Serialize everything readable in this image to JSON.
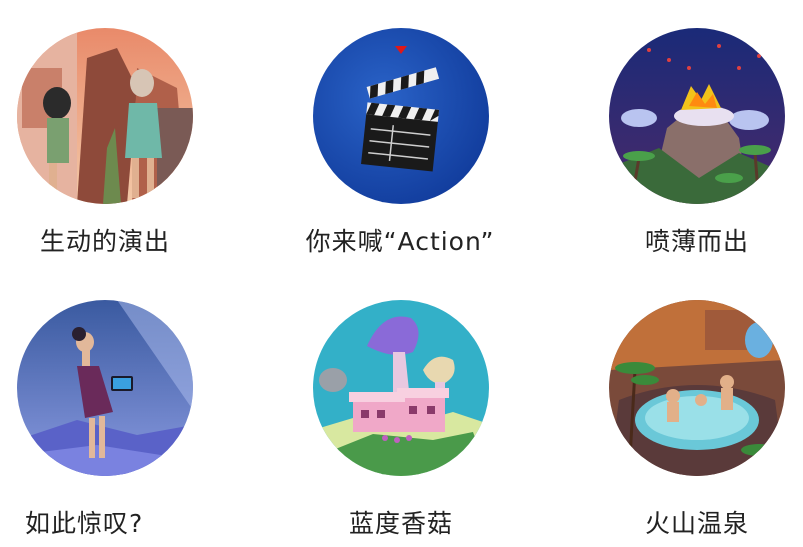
{
  "grid": {
    "items": [
      {
        "caption": "生动的演出",
        "icon": "performers-scene-icon"
      },
      {
        "caption": "你来喊“Action”",
        "icon": "clapperboard-icon"
      },
      {
        "caption": "喷薄而出",
        "icon": "volcano-eruption-icon"
      },
      {
        "caption": "如此惊叹?",
        "icon": "girl-with-tablet-icon"
      },
      {
        "caption": "蓝度香菇",
        "icon": "mushroom-house-icon"
      },
      {
        "caption": "火山温泉",
        "icon": "hot-spring-icon"
      }
    ]
  }
}
